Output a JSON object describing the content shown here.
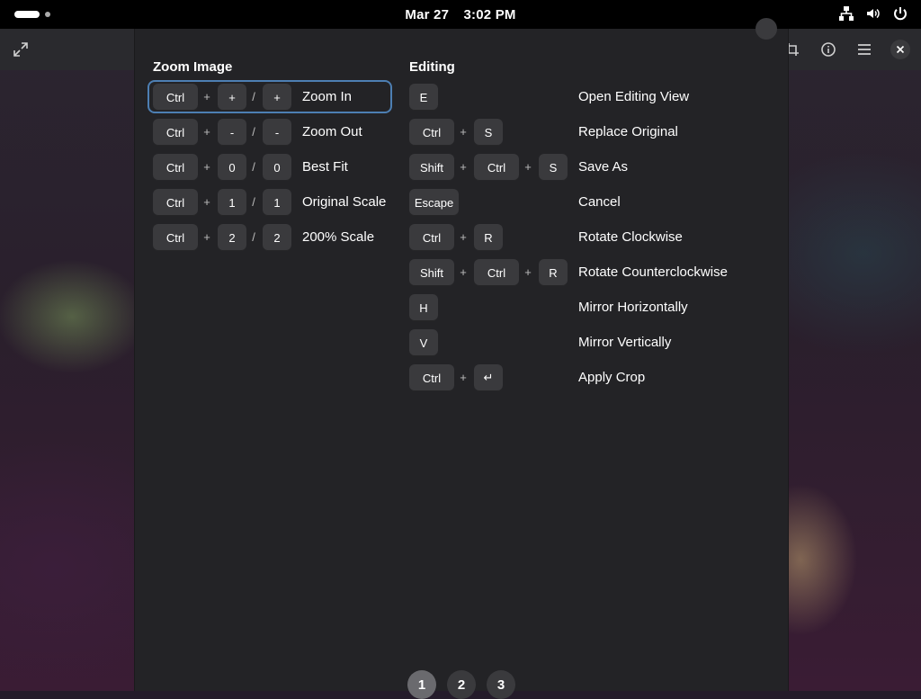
{
  "topbar": {
    "date": "Mar 27",
    "time": "3:02 PM",
    "icons": [
      "activities-pill-icon",
      "workspace-dot-icon",
      "network-icon",
      "volume-icon",
      "power-icon"
    ]
  },
  "headerbar": {
    "icons": [
      "fullscreen-icon",
      "crop-icon",
      "info-icon",
      "menu-icon",
      "close-icon"
    ]
  },
  "zoom": {
    "title": "Zoom Image",
    "rows": [
      {
        "keys": [
          "Ctrl",
          "+",
          "+"
        ],
        "label": "Zoom In"
      },
      {
        "keys": [
          "Ctrl",
          "-",
          "-"
        ],
        "label": "Zoom Out"
      },
      {
        "keys": [
          "Ctrl",
          "0",
          "0"
        ],
        "label": "Best Fit"
      },
      {
        "keys": [
          "Ctrl",
          "1",
          "1"
        ],
        "label": "Original Scale"
      },
      {
        "keys": [
          "Ctrl",
          "2",
          "2"
        ],
        "label": "200% Scale"
      }
    ],
    "plus": "+",
    "slash": "/"
  },
  "editing": {
    "title": "Editing",
    "plus": "+",
    "rows": [
      {
        "keys": [
          "E"
        ],
        "label": "Open Editing View"
      },
      {
        "keys": [
          "Ctrl",
          "S"
        ],
        "label": "Replace Original"
      },
      {
        "keys": [
          "Shift",
          "Ctrl",
          "S"
        ],
        "label": "Save As"
      },
      {
        "keys": [
          "Escape"
        ],
        "label": "Cancel"
      },
      {
        "keys": [
          "Ctrl",
          "R"
        ],
        "label": "Rotate Clockwise"
      },
      {
        "keys": [
          "Shift",
          "Ctrl",
          "R"
        ],
        "label": "Rotate Counterclockwise"
      },
      {
        "keys": [
          "H"
        ],
        "label": "Mirror Horizontally"
      },
      {
        "keys": [
          "V"
        ],
        "label": "Mirror Vertically"
      },
      {
        "keys": [
          "Ctrl",
          "↵"
        ],
        "label": "Apply Crop"
      }
    ]
  },
  "pager": {
    "pages": [
      "1",
      "2",
      "3"
    ],
    "active": "1"
  },
  "colors": {
    "focus": "#4d7fb3",
    "key_bg": "#3a3a3d",
    "dialog_bg": "#232326"
  }
}
